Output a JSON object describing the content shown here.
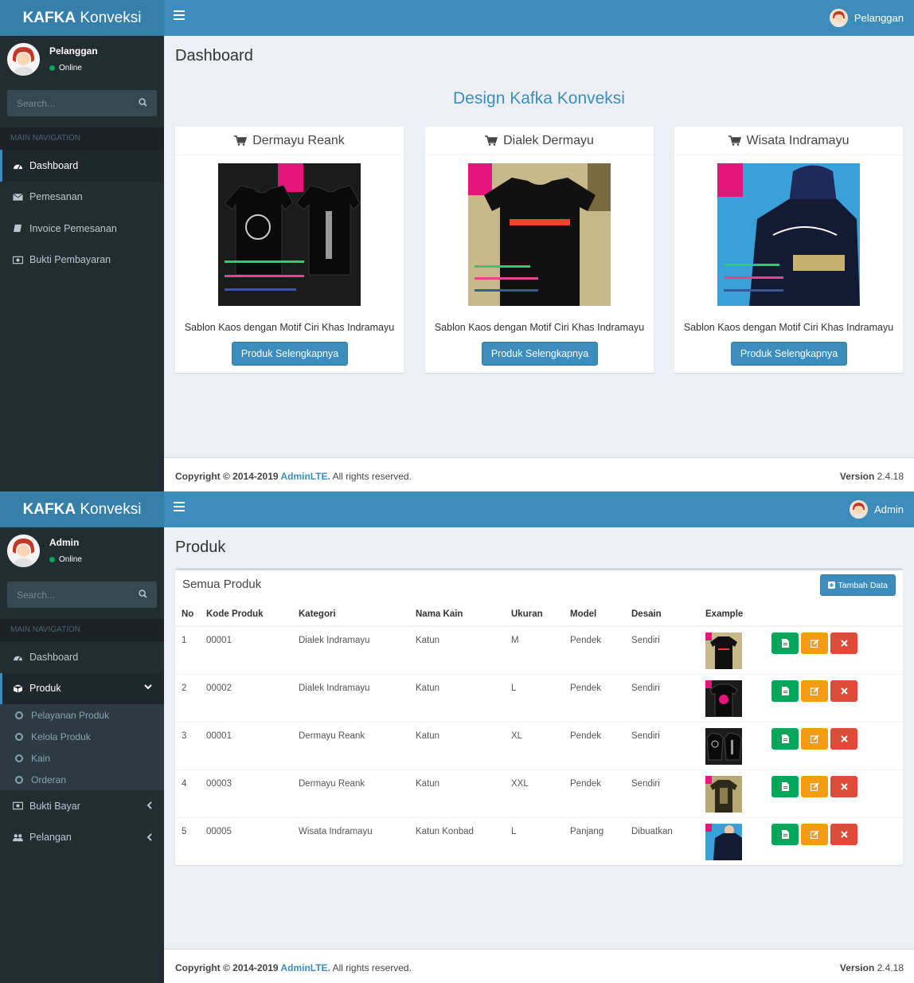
{
  "screen1": {
    "logo": {
      "bold": "KAFKA",
      "rest": " Konveksi"
    },
    "topbar_user": "Pelanggan",
    "sidebar": {
      "user_name": "Pelanggan",
      "status": "Online",
      "search_placeholder": "Search...",
      "nav_header": "MAIN NAVIGATION",
      "items": [
        {
          "label": "Dashboard",
          "icon": "dashboard-icon"
        },
        {
          "label": "Pemesanan",
          "icon": "envelope-icon"
        },
        {
          "label": "Invoice Pemesanan",
          "icon": "book-icon"
        },
        {
          "label": "Bukti Pembayaran",
          "icon": "money-icon"
        }
      ]
    },
    "page_title": "Dashboard",
    "section_title": "Design Kafka Konveksi",
    "cards": [
      {
        "title": "Dermayu Reank",
        "desc": "Sablon Kaos dengan Motif Ciri Khas Indramayu",
        "button": "Produk Selengkapnya"
      },
      {
        "title": "Dialek Dermayu",
        "desc": "Sablon Kaos dengan Motif Ciri Khas Indramayu",
        "button": "Produk Selengkapnya"
      },
      {
        "title": "Wisata Indramayu",
        "desc": "Sablon Kaos dengan Motif Ciri Khas Indramayu",
        "button": "Produk Selengkapnya"
      }
    ],
    "footer": {
      "copy_pre": "Copyright © 2014-2019 ",
      "brand": "AdminLTE.",
      "copy_post": " All rights reserved.",
      "version_label": "Version",
      "version": "2.4.18"
    }
  },
  "screen2": {
    "logo": {
      "bold": "KAFKA",
      "rest": " Konveksi"
    },
    "topbar_user": "Admin",
    "sidebar": {
      "user_name": "Admin",
      "status": "Online",
      "search_placeholder": "Search...",
      "nav_header": "MAIN NAVIGATION",
      "items": [
        {
          "label": "Dashboard",
          "icon": "dashboard-icon"
        },
        {
          "label": "Produk",
          "icon": "cube-icon"
        },
        {
          "label": "Bukti Bayar",
          "icon": "money-icon"
        },
        {
          "label": "Pelangan",
          "icon": "users-icon"
        }
      ],
      "subitems": [
        "Pelayanan Produk",
        "Kelola Produk",
        "Kain",
        "Orderan"
      ]
    },
    "page_title": "Produk",
    "box_title": "Semua Produk",
    "add_button": "Tambah Data",
    "table": {
      "headers": [
        "No",
        "Kode Produk",
        "Kategori",
        "Nama Kain",
        "Ukuran",
        "Model",
        "Desain",
        "Example"
      ],
      "rows": [
        [
          "1",
          "00001",
          "Dialek Indramayu",
          "Katun",
          "M",
          "Pendek",
          "Sendiri"
        ],
        [
          "2",
          "00002",
          "Dialek Indramayu",
          "Katun",
          "L",
          "Pendek",
          "Sendiri"
        ],
        [
          "3",
          "00001",
          "Dermayu Reank",
          "Katun",
          "XL",
          "Pendek",
          "Sendiri"
        ],
        [
          "4",
          "00003",
          "Dermayu Reank",
          "Katun",
          "XXL",
          "Pendek",
          "Sendiri"
        ],
        [
          "5",
          "00005",
          "Wisata Indramayu",
          "Katun Konbad",
          "L",
          "Panjang",
          "Dibuatkan"
        ]
      ]
    },
    "footer": {
      "copy_pre": "Copyright © 2014-2019 ",
      "brand": "AdminLTE.",
      "copy_post": " All rights reserved.",
      "version_label": "Version",
      "version": "2.4.18"
    }
  }
}
